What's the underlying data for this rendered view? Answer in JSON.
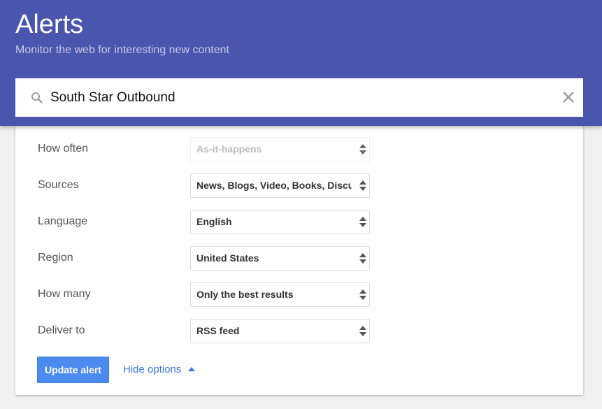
{
  "header": {
    "title": "Alerts",
    "subtitle": "Monitor the web for interesting new content"
  },
  "search": {
    "query": "South Star Outbound",
    "search_icon": "search-icon",
    "clear_icon": "close-icon"
  },
  "options": [
    {
      "label": "How often",
      "value": "As-it-happens",
      "disabled": true
    },
    {
      "label": "Sources",
      "value": "News, Blogs, Video, Books, Discussions"
    },
    {
      "label": "Language",
      "value": "English"
    },
    {
      "label": "Region",
      "value": "United States"
    },
    {
      "label": "How many",
      "value": "Only the best results"
    },
    {
      "label": "Deliver to",
      "value": "RSS feed"
    }
  ],
  "actions": {
    "update_label": "Update alert",
    "hide_options_label": "Hide options"
  },
  "colors": {
    "header": "#4a55ad",
    "button": "#4b8bf0",
    "link": "#3b78e7"
  }
}
